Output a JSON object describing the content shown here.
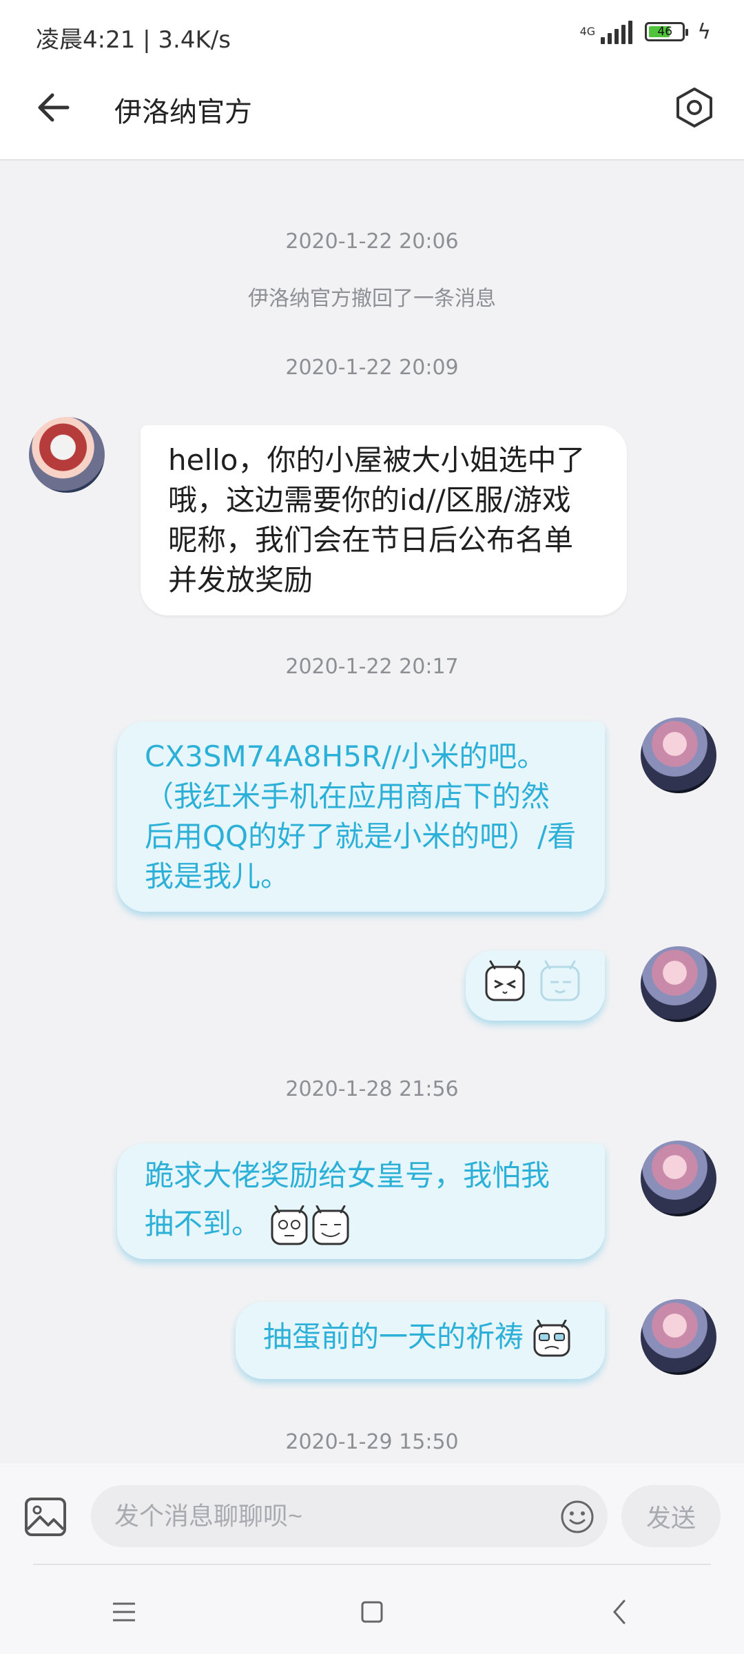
{
  "status": {
    "time_speed": "凌晨4:21 | 3.4K/s",
    "network": "4G",
    "battery": "46"
  },
  "header": {
    "title": "伊洛纳官方",
    "back_icon": "arrow-left-icon",
    "settings_icon": "hexagon-gear-icon"
  },
  "messages": {
    "t1": "2020-1-22 20:06",
    "recall": "伊洛纳官方撤回了一条消息",
    "t2": "2020-1-22 20:09",
    "in1": "hello，你的小屋被大小姐选中了哦，这边需要你的id//区服/游戏昵称，我们会在节日后公布名单并发放奖励",
    "t3": "2020-1-22 20:17",
    "out1": "CX3SM74A8H5R//小米的吧。（我红米手机在应用商店下的然后用QQ的好了就是小米的吧）/看我是我儿。",
    "out2_emoji": "bilibili-emoji-icons",
    "t4": "2020-1-28 21:56",
    "out3": "跪求大佬奖励给女皇号，我怕我抽不到。",
    "out4": "抽蛋前的一天的祈祷",
    "t5": "2020-1-29 15:50"
  },
  "composer": {
    "placeholder": "发个消息聊聊呗~",
    "send": "发送",
    "image_icon": "image-icon",
    "emoji_icon": "smiley-icon"
  },
  "nav": {
    "menu_icon": "menu-icon",
    "home_icon": "square-home-icon",
    "back_icon": "chevron-back-icon"
  },
  "colors": {
    "outgoing_text": "#2cb0d8",
    "outgoing_bg": "#e6f6fb",
    "chat_bg": "#f2f2f4"
  }
}
